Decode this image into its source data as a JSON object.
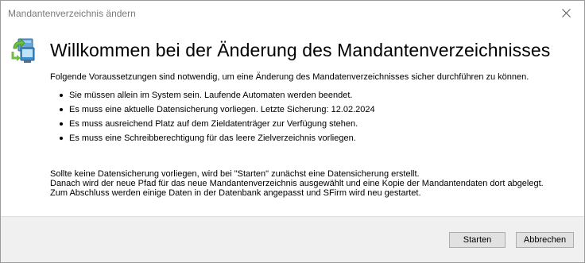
{
  "window": {
    "title": "Mandantenverzeichnis ändern",
    "close_icon": "close-icon"
  },
  "header": {
    "icon": "directory-transfer-icon",
    "heading": "Willkommen bei der Änderung des Mandantenverzeichnisses"
  },
  "content": {
    "intro": "Folgende Voraussetzungen sind notwendig, um eine Änderung des Mandatenverzeichnisses sicher durchführen zu können.",
    "bullets": [
      "Sie müssen allein im System sein. Laufende Automaten werden beendet.",
      "Es muss eine aktuelle Datensicherung vorliegen. Letzte Sicherung: 12.02.2024",
      "Es muss ausreichend Platz auf dem Zieldatenträger zur Verfügung stehen.",
      "Es muss eine Schreibberechtigung für das leere Zielverzeichnis vorliegen."
    ],
    "notes": [
      "Sollte keine Datensicherung vorliegen, wird bei \"Starten\" zunächst eine Datensicherung erstellt.",
      "Danach wird der neue Pfad für das neue Mandantenverzeichnis ausgewählt und eine Kopie der Mandantendaten dort abgelegt.",
      "Zum Abschluss werden einige Daten in der Datenbank angepasst und SFirm wird neu gestartet."
    ]
  },
  "footer": {
    "start_label": "Starten",
    "cancel_label": "Abbrechen"
  },
  "colors": {
    "title_text": "#7a7a7a",
    "footer_bg": "#f0f0f0",
    "button_bg": "#e1e1e1",
    "button_border": "#adadad"
  }
}
